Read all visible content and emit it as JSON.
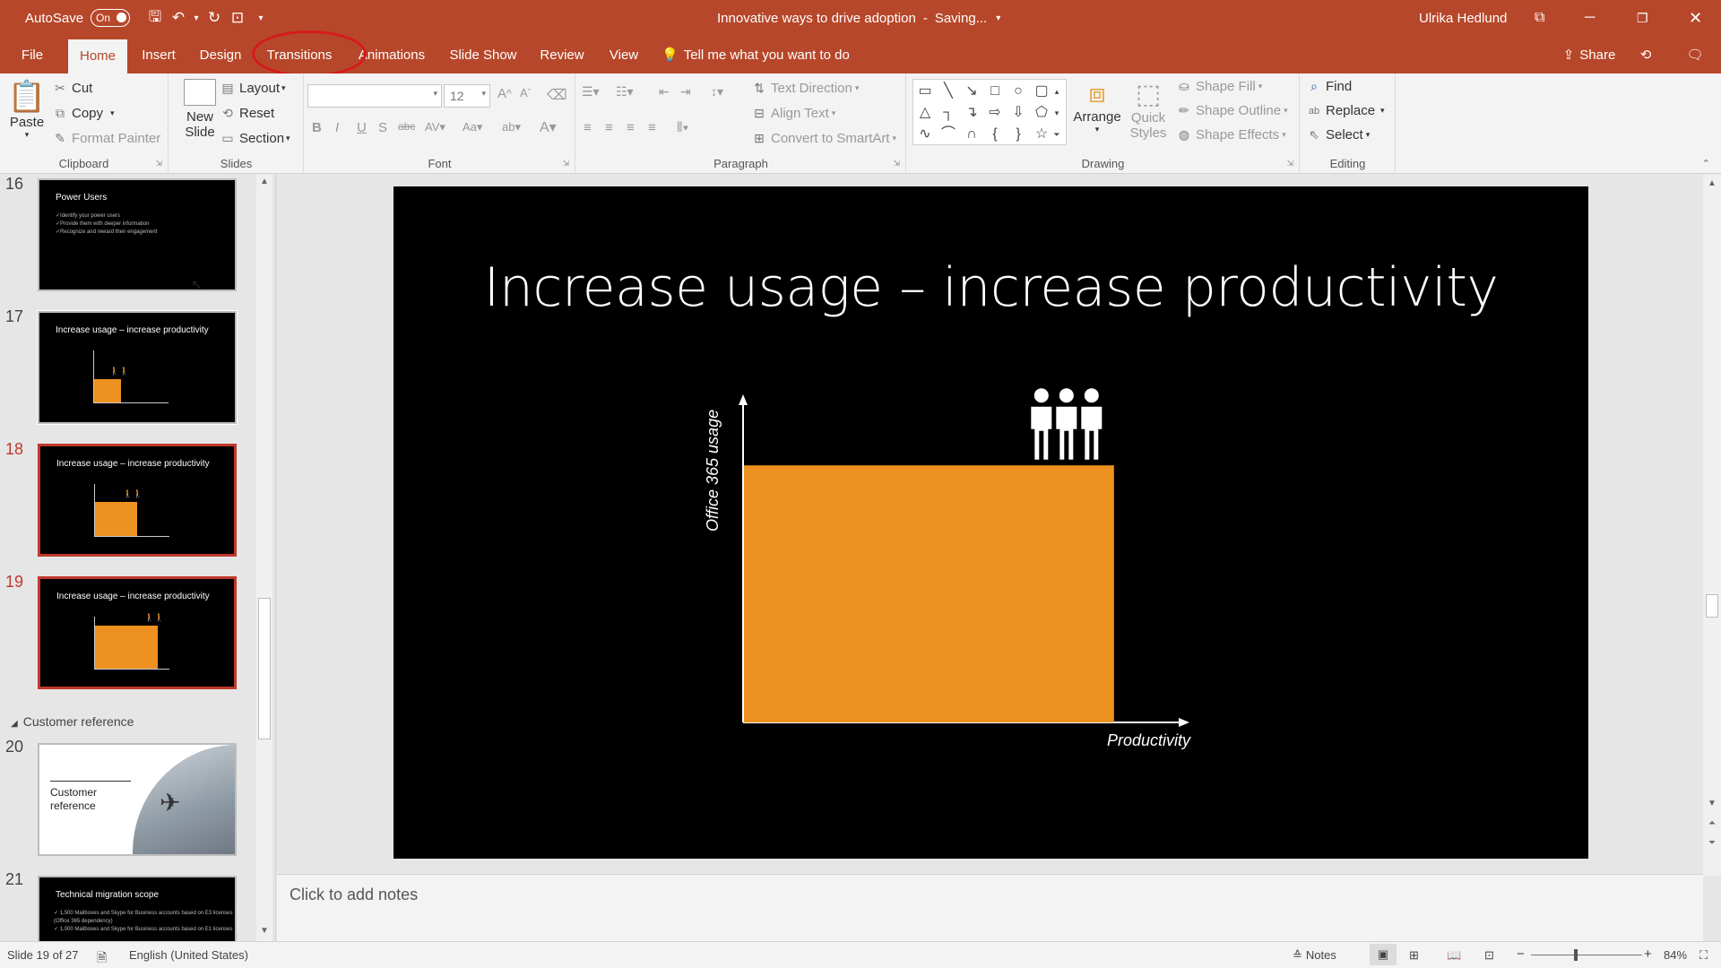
{
  "titlebar": {
    "autosave_label": "AutoSave",
    "autosave_state": "On",
    "document_title": "Innovative ways to drive adoption",
    "save_status": "Saving...",
    "user_name": "Ulrika Hedlund"
  },
  "tabs": [
    "File",
    "Home",
    "Insert",
    "Design",
    "Transitions",
    "Animations",
    "Slide Show",
    "Review",
    "View"
  ],
  "tell_me": "Tell me what you want to do",
  "share_label": "Share",
  "ribbon": {
    "clipboard": {
      "paste": "Paste",
      "cut": "Cut",
      "copy": "Copy",
      "format_painter": "Format Painter",
      "label": "Clipboard"
    },
    "slides": {
      "new_slide_1": "New",
      "new_slide_2": "Slide",
      "layout": "Layout",
      "reset": "Reset",
      "section": "Section",
      "label": "Slides"
    },
    "font": {
      "size": "12",
      "label": "Font"
    },
    "paragraph": {
      "text_direction": "Text Direction",
      "align_text": "Align Text",
      "convert_smartart": "Convert to SmartArt",
      "label": "Paragraph"
    },
    "drawing": {
      "arrange": "Arrange",
      "quick_styles_1": "Quick",
      "quick_styles_2": "Styles",
      "shape_fill": "Shape Fill",
      "shape_outline": "Shape Outline",
      "shape_effects": "Shape Effects",
      "label": "Drawing"
    },
    "editing": {
      "find": "Find",
      "replace": "Replace",
      "select": "Select",
      "label": "Editing"
    }
  },
  "thumbnails": [
    {
      "num": "16",
      "title": "Power Users",
      "bullets": [
        "✓Identify your power users",
        "✓Provide them with deeper information",
        "✓Recognize and reward their engagement"
      ]
    },
    {
      "num": "17",
      "title": "Increase usage – increase productivity"
    },
    {
      "num": "18",
      "title": "Increase usage – increase productivity"
    },
    {
      "num": "19",
      "title": "Increase usage – increase productivity"
    },
    {
      "num": "20",
      "title": "Customer reference"
    },
    {
      "num": "21",
      "title": "Technical migration scope",
      "bullets": [
        "✓ 1,500 Mailboxes and Skype for Business accounts based on E3 licenses",
        "(Office 365 dependency)",
        "✓ 1,000 Mailboxes and Skype for Business accounts based on E1 licenses"
      ]
    }
  ],
  "section_label": "Customer reference",
  "slide": {
    "title": "Increase usage – increase productivity"
  },
  "chart_data": {
    "type": "bar",
    "title": "Increase usage – increase productivity",
    "xlabel": "Productivity",
    "ylabel": "Office 365 usage",
    "categories": [
      ""
    ],
    "values": [
      0.6
    ],
    "bar_width_fraction": 0.86,
    "bar_color": "#ed9121",
    "grid": false
  },
  "notes_placeholder": "Click to add notes",
  "status": {
    "slide_info": "Slide 19 of 27",
    "language": "English (United States)",
    "notes_label": "Notes",
    "zoom": "84%"
  },
  "colors": {
    "accent": "#b7472a",
    "bar": "#ed9121",
    "selection": "#c0392b",
    "annotation_circle": "#d51b1b"
  }
}
